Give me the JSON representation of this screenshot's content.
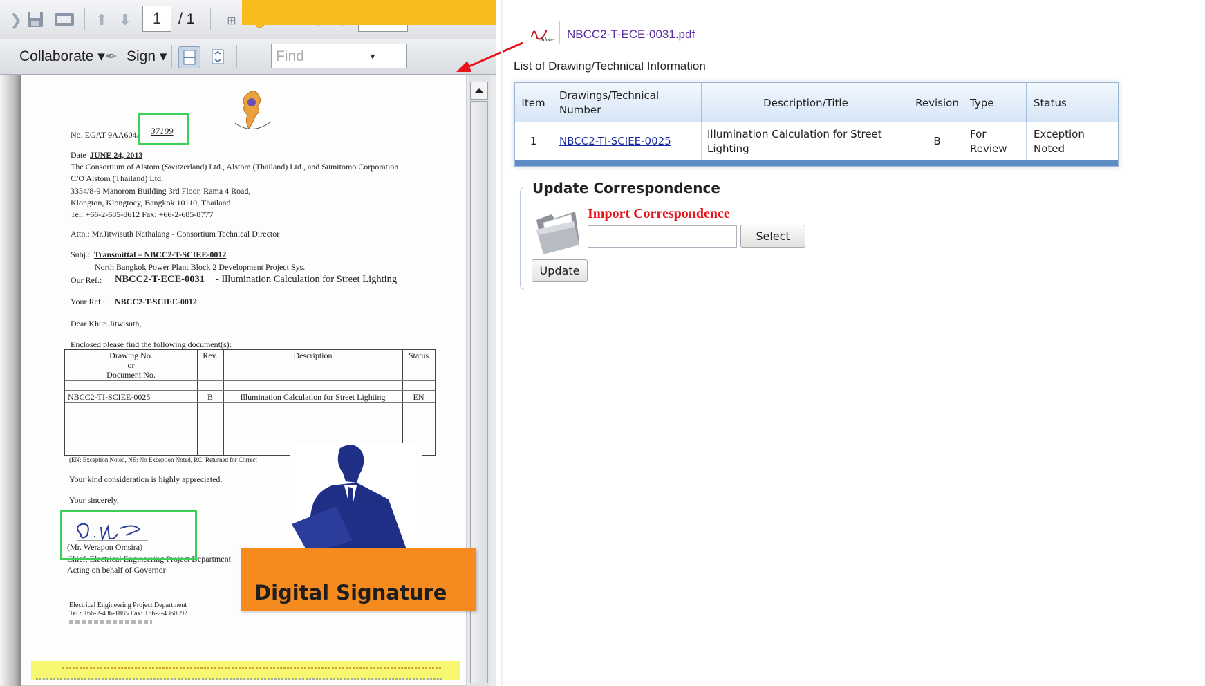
{
  "viewer": {
    "page_current": "1",
    "page_total": "/ 1",
    "collaborate_label": "Collaborate ▾",
    "sign_label": "Sign ▾",
    "find_placeholder": "Find"
  },
  "letter": {
    "ref_prefix": "No. EGAT 9AA604/",
    "ref_number": "37109",
    "date_label": "Date",
    "date_value": "JUNE 24, 2013",
    "address": [
      "The Consortium of Alstom (Switzerland) Ltd., Alstom (Thailand) Ltd., and Sumitomo Corporation",
      "C/O Alstom (Thailand) Ltd.",
      "3354/8-9 Manorom Building 3rd Floor, Rama 4 Road,",
      "Klongton, Klongtoey, Bangkok 10110, Thailand",
      "Tel: +66-2-685-8612  Fax: +66-2-685-8777"
    ],
    "attn": "Attn.: Mr.Jitwisuth Nathalang - Consortium Technical Director",
    "subj_label": "Subj.:",
    "subj_value": "Transmittal – NBCC2-T-SCIEE-0012",
    "subj_line2": "North Bangkok Power Plant Block 2 Development Project Sys.",
    "our_ref_label": "Our Ref.:",
    "our_ref_value": "NBCC2-T-ECE-0031",
    "our_ref_desc": " - Illumination Calculation for Street Lighting",
    "your_ref_label": "Your Ref.:",
    "your_ref_value": "NBCC2-T-SCIEE-0012",
    "salutation": "Dear Khun Jitwisuth,",
    "enclosed": "Enclosed please find the following document(s):",
    "table_headers": {
      "drawing": "Drawing No.",
      "or": "or",
      "docno": "Document No.",
      "rev": "Rev.",
      "desc": "Description",
      "status": "Status"
    },
    "table_row": {
      "drawing": "NBCC2-TI-SCIEE-0025",
      "rev": "B",
      "desc": "Illumination Calculation for Street Lighting",
      "status": "EN"
    },
    "legend_note": "(EN: Exception Noted, NE: No Exception Noted, RC: Returned for Correct",
    "closing1": "Your kind consideration is highly appreciated.",
    "closing2": "Your sincerely,",
    "signer": "(Mr. Werapon Omsira)",
    "signer_title": "Chief, Electrical Engineering Project Department",
    "acting": "Acting on behalf of Governor",
    "dept": "Electrical Engineering Project Department",
    "dept_tel": "Tel.: +66-2-436-1885 Fax: +66-2-4360592"
  },
  "right": {
    "pdf_icon_text": "Adobe",
    "pdf_link": "NBCC2-T-ECE-0031.pdf",
    "list_title": "List of Drawing/Technical Information",
    "table": {
      "headers": [
        "Item",
        "Drawings/Technical Number",
        "Description/Title",
        "Revision",
        "Type",
        "Status"
      ],
      "rows": [
        [
          "1",
          "NBCC2-TI-SCIEE-0025",
          "Illumination Calculation for Street Lighting",
          "B",
          "For Review",
          "Exception Noted"
        ]
      ]
    },
    "update_title": "Update Correspondence",
    "import_label": "Import Correspondence",
    "select_label": "Select",
    "update_label": "Update"
  },
  "callout": {
    "signature_label": "Digital Signature"
  },
  "colors": {
    "banner": "#f8bd1d",
    "callout": "#f58a1f",
    "import_red": "#e8141c",
    "link_purple": "#5a2ca0",
    "table_header_blue": "#d6e6f7",
    "highlight_green": "#3ccf5a"
  }
}
